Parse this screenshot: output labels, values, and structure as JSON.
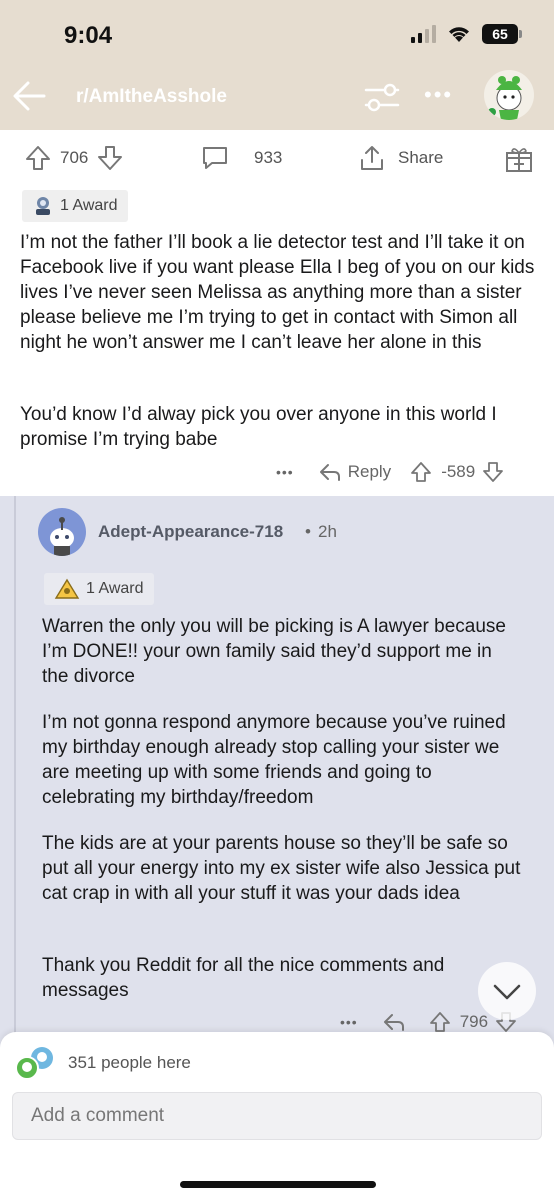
{
  "status_bar": {
    "time": "9:04",
    "battery": "65"
  },
  "nav": {
    "subreddit": "r/AmItheAsshole"
  },
  "post_actions": {
    "votes": "706",
    "comments": "933",
    "share_label": "Share"
  },
  "post_comment": {
    "award": "1 Award",
    "paragraphs": [
      "I’m not the father I’ll book a lie detector test and I’ll take it on Facebook live if you want please Ella I beg of you on our kids lives I’ve never seen Melissa as anything more than a sister please believe me I’m trying to get in contact with Simon all night he won’t answer me I can’t leave her alone in this",
      "You’d know I’d alway pick you over anyone in this world I promise I’m trying babe"
    ],
    "more": "•••",
    "reply_label": "Reply",
    "score": "-589"
  },
  "reply_comment": {
    "author": "Adept-Appearance-718",
    "time": "2h",
    "award": "1 Award",
    "paragraphs": [
      "Warren the only you will be picking is A lawyer because I’m DONE!! your own family said they’d support me in the divorce",
      "I’m not gonna respond anymore because you’ve ruined my birthday enough already stop calling your sister we are meeting up with some friends and going to celebrating my birthday/freedom",
      "The kids are at your parents house so they’ll be safe so put all your energy into my ex sister wife also Jessica put cat crap in with all your stuff it was your dads idea",
      "Thank you Reddit for all the nice comments and messages"
    ],
    "more": "•••",
    "score": "796"
  },
  "bottom": {
    "people_here": "351 people here",
    "add_comment_placeholder": "Add a comment"
  },
  "colors": {
    "top_bar": "#e6ddd0",
    "thread_bg": "#dfe1ec"
  }
}
